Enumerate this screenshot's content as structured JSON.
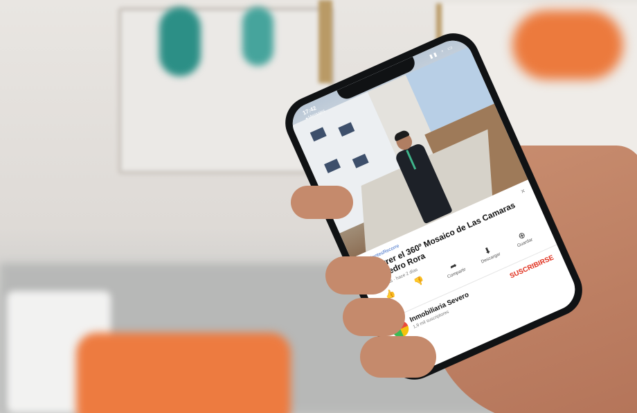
{
  "status_bar": {
    "time": "17:42",
    "back_label": "◂ Mensajes"
  },
  "video": {
    "hashtag": "#CorrientesRecorre",
    "title": "Recorrer el 360º Mosaico de Las Camaras con Pedro Rora",
    "meta": "8 mil vistas · hace 2 días"
  },
  "actions": [
    {
      "icon": "thumbs-up-icon",
      "glyph": "👍",
      "label": ""
    },
    {
      "icon": "thumbs-down-icon",
      "glyph": "👎",
      "label": ""
    },
    {
      "icon": "share-icon",
      "glyph": "➦",
      "label": "Compartir"
    },
    {
      "icon": "download-icon",
      "glyph": "⬇",
      "label": "Descargar"
    },
    {
      "icon": "save-icon",
      "glyph": "⊕",
      "label": "Guardar"
    }
  ],
  "channel": {
    "name": "Inmobiliaria Severo",
    "subs": "1,9 mil suscriptores",
    "subscribe": "SUSCRIBIRSE"
  },
  "colors": {
    "accent_red": "#e0301e",
    "link_blue": "#3b6bc5"
  }
}
